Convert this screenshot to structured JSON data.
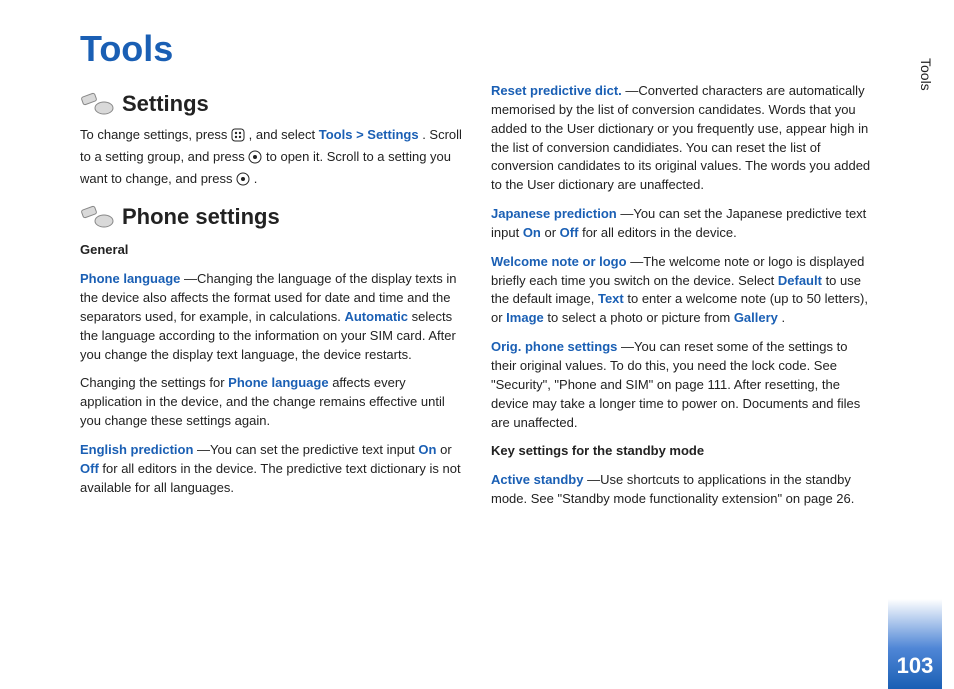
{
  "side_tab": "Tools",
  "page_number": "103",
  "chapter_title": "Tools",
  "settings": {
    "heading": "Settings",
    "intro_pre": "To change settings, press ",
    "menu_path": "Tools > Settings",
    "intro_post": ". Scroll to a setting group, and press ",
    "intro_post2": " to open it. Scroll to a setting you want to change, and press ",
    "intro_end": "."
  },
  "phone_settings": {
    "heading": "Phone settings",
    "general_label": "General",
    "phone_language_label": "Phone language",
    "phone_language_text": "—Changing the language of the display texts in the device also affects the format used for date and time and the separators used, for example, in calculations. ",
    "automatic_label": "Automatic",
    "phone_language_text2": " selects the language according to the information on your SIM card. After you change the display text language, the device restarts.",
    "phone_lang_para2_pre": "Changing the settings for ",
    "phone_lang_para2_mid": "Phone language",
    "phone_lang_para2_post": " affects every application in the device, and the change remains effective until you change these settings again.",
    "english_pred_label": "English prediction",
    "english_pred_text_pre": "—You can set the predictive text input ",
    "on": "On",
    "or": " or ",
    "off": "Off",
    "english_pred_text_post": " for all editors in the device. The predictive text dictionary is not available for all languages.",
    "reset_pred_label": "Reset predictive dict.",
    "reset_pred_text": "—Converted characters are automatically memorised by the list of conversion candidates. Words that you added to the User dictionary or you frequently use, appear high in the list of conversion candidiates. You can reset the list of conversion candidates to its original values. The words you added to the User dictionary are unaffected.",
    "jp_pred_label": "Japanese prediction",
    "jp_pred_text_pre": "—You can set the Japanese predictive text input ",
    "jp_pred_text_post": " for all editors in the device.",
    "welcome_label": "Welcome note or logo",
    "welcome_text_pre": "—The welcome note or logo is displayed briefly each time you switch on the device. Select ",
    "default_label": "Default",
    "welcome_text_mid1": " to use the default image, ",
    "text_label": "Text",
    "welcome_text_mid2": " to enter a welcome note (up to 50 letters), or ",
    "image_label": "Image",
    "welcome_text_mid3": " to select a photo or picture from ",
    "gallery_label": "Gallery",
    "welcome_text_end": ".",
    "orig_label": "Orig. phone settings",
    "orig_text": "—You can reset some of the settings to their original values. To do this, you need the lock code. See \"Security\", \"Phone and SIM\" on page 111. After resetting, the device may take a longer time to power on. Documents and files are unaffected.",
    "key_standby_heading": "Key settings for the standby mode",
    "active_standby_label": "Active standby",
    "active_standby_text": "—Use shortcuts to applications in the standby mode. See \"Standby mode functionality extension\" on page 26."
  }
}
